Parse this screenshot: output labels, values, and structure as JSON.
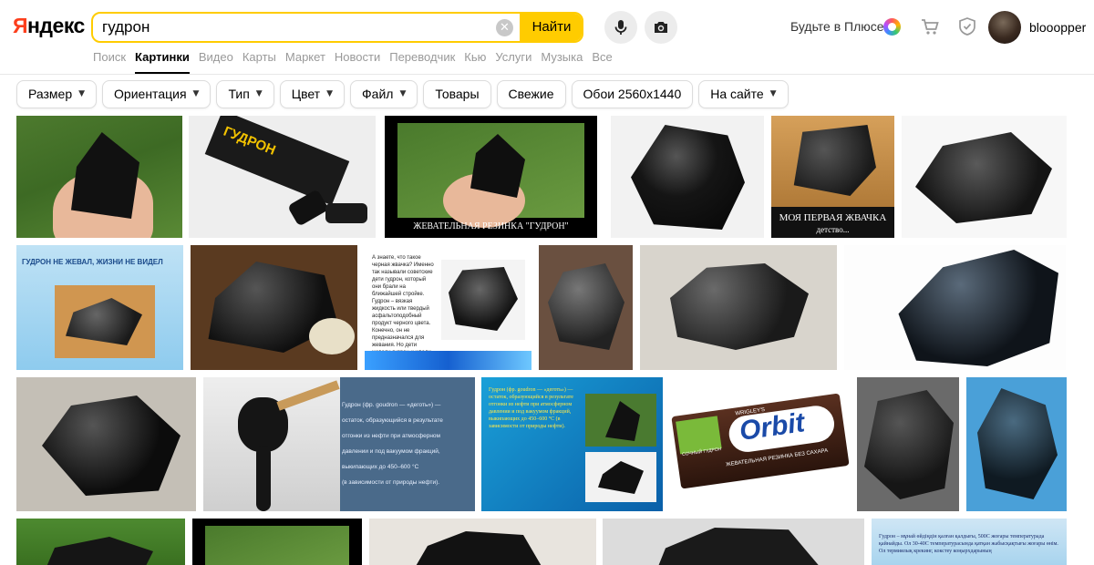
{
  "header": {
    "logo": "Яндекс",
    "search_value": "гудрон",
    "search_button": "Найти",
    "clear_symbol": "✕",
    "plus_label": "Будьте в Плюсе",
    "username": "blooopper"
  },
  "tabs": [
    {
      "label": "Поиск",
      "active": false
    },
    {
      "label": "Картинки",
      "active": true
    },
    {
      "label": "Видео",
      "active": false
    },
    {
      "label": "Карты",
      "active": false
    },
    {
      "label": "Маркет",
      "active": false
    },
    {
      "label": "Новости",
      "active": false
    },
    {
      "label": "Переводчик",
      "active": false
    },
    {
      "label": "Кью",
      "active": false
    },
    {
      "label": "Услуги",
      "active": false
    },
    {
      "label": "Музыка",
      "active": false
    },
    {
      "label": "Все",
      "active": false
    }
  ],
  "filters": [
    {
      "label": "Размер",
      "dropdown": true
    },
    {
      "label": "Ориентация",
      "dropdown": true
    },
    {
      "label": "Тип",
      "dropdown": true
    },
    {
      "label": "Цвет",
      "dropdown": true
    },
    {
      "label": "Файл",
      "dropdown": true
    },
    {
      "label": "Товары",
      "dropdown": false
    },
    {
      "label": "Свежие",
      "dropdown": false
    },
    {
      "label": "Обои 2560x1440",
      "dropdown": false
    },
    {
      "label": "На сайте",
      "dropdown": true
    }
  ],
  "image_captions": {
    "pack_text": "ГУДРОН",
    "gum_caption": "ЖЕВАТЕЛЬНАЯ РЕЗИНКА \"ГУДРОН\"",
    "first_gum_caption": "МОЯ ПЕРВАЯ ЖВАЧКА",
    "first_gum_sub": "детство...",
    "never_chewed": "ГУДРОН НЕ ЖЕВАЛ, ЖИЗНИ НЕ ВИДЕЛ",
    "article_text": "А знаете, что такое черная жвачка? Именно так называли советские дети гудрон, который они брали на ближайшей стройке. Гудрон – вязкая жидкость или твердый асфальтоподобный продукт черного цвета. Конечно, он не предназначался для жевания. Но дети жевали гудрон и жвали, без последствий для организма. Когда их видели взрослые за этим",
    "definition_text": "Гудрон (фр. goudron — «деготь») — остаток, образующийся в результате отгонки из нефти при атмосферном давлении и под вакуумом фракций, выкипающих до 450–600 °С (в зависимости от природы нефти).",
    "definition_line1": "Гудрон (фр. goudron — «деготь») —",
    "definition_line2": "остаток, образующийся в результате",
    "definition_line3": "отгонки из нефти при атмосферном",
    "definition_line4": "давлении и под вакуумом фракций,",
    "definition_line5": "выкипающих до 450–600 °С",
    "definition_line6": "(в зависимости от природы нефти).",
    "orbit_brand": "Orbit",
    "orbit_small": "WRIGLEY'S",
    "orbit_sub": "ЖЕВАТЕЛЬНАЯ РЕЗИНКА БЕЗ САХАРА",
    "orbit_flavor": "СОЧНЫЙ ГУДРОН",
    "kz_text": "Гудрон – мұнай өйдіңдін қалған қалдығы, 500С жоғары температурада қайнайды. Ол 30-40С температурасында қатқан жабысқақтығы жоғары өнім. Ол термиялық крекинг, кокстеу коңырхдарының"
  }
}
